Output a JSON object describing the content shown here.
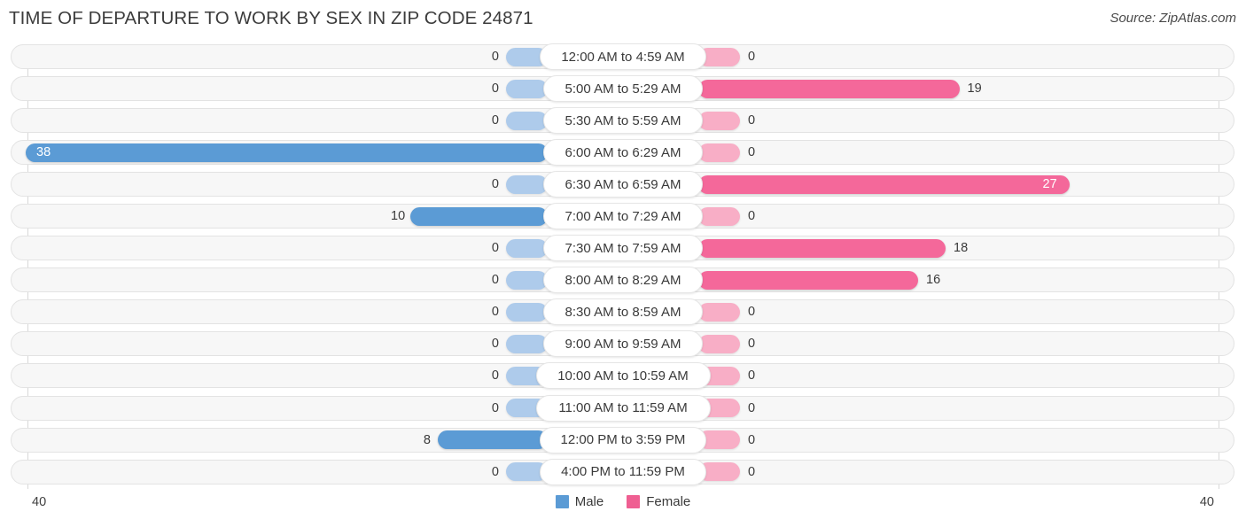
{
  "header": {
    "title": "TIME OF DEPARTURE TO WORK BY SEX IN ZIP CODE 24871",
    "source": "Source: ZipAtlas.com"
  },
  "legend": {
    "male_label": "Male",
    "female_label": "Female",
    "male_color": "#5b9bd5",
    "female_color": "#ef5f92"
  },
  "axis": {
    "left_max": "40",
    "right_max": "40"
  },
  "chart_data": {
    "type": "bar",
    "orientation": "horizontal-diverging",
    "title": "TIME OF DEPARTURE TO WORK BY SEX IN ZIP CODE 24871",
    "xlabel": "",
    "ylabel": "",
    "xlim": [
      40,
      40
    ],
    "grid": true,
    "legend_position": "bottom-center",
    "categories": [
      "12:00 AM to 4:59 AM",
      "5:00 AM to 5:29 AM",
      "5:30 AM to 5:59 AM",
      "6:00 AM to 6:29 AM",
      "6:30 AM to 6:59 AM",
      "7:00 AM to 7:29 AM",
      "7:30 AM to 7:59 AM",
      "8:00 AM to 8:29 AM",
      "8:30 AM to 8:59 AM",
      "9:00 AM to 9:59 AM",
      "10:00 AM to 10:59 AM",
      "11:00 AM to 11:59 AM",
      "12:00 PM to 3:59 PM",
      "4:00 PM to 11:59 PM"
    ],
    "series": [
      {
        "name": "Male",
        "values": [
          0,
          0,
          0,
          38,
          0,
          10,
          0,
          0,
          0,
          0,
          0,
          0,
          8,
          0
        ]
      },
      {
        "name": "Female",
        "values": [
          0,
          19,
          0,
          0,
          27,
          0,
          18,
          16,
          0,
          0,
          0,
          0,
          0,
          0
        ]
      }
    ]
  },
  "rows": [
    {
      "label": "12:00 AM to 4:59 AM",
      "male": "0",
      "female": "0"
    },
    {
      "label": "5:00 AM to 5:29 AM",
      "male": "0",
      "female": "19"
    },
    {
      "label": "5:30 AM to 5:59 AM",
      "male": "0",
      "female": "0"
    },
    {
      "label": "6:00 AM to 6:29 AM",
      "male": "38",
      "female": "0"
    },
    {
      "label": "6:30 AM to 6:59 AM",
      "male": "0",
      "female": "27"
    },
    {
      "label": "7:00 AM to 7:29 AM",
      "male": "10",
      "female": "0"
    },
    {
      "label": "7:30 AM to 7:59 AM",
      "male": "0",
      "female": "18"
    },
    {
      "label": "8:00 AM to 8:29 AM",
      "male": "0",
      "female": "16"
    },
    {
      "label": "8:30 AM to 8:59 AM",
      "male": "0",
      "female": "0"
    },
    {
      "label": "9:00 AM to 9:59 AM",
      "male": "0",
      "female": "0"
    },
    {
      "label": "10:00 AM to 10:59 AM",
      "male": "0",
      "female": "0"
    },
    {
      "label": "11:00 AM to 11:59 AM",
      "male": "0",
      "female": "0"
    },
    {
      "label": "12:00 PM to 3:59 PM",
      "male": "8",
      "female": "0"
    },
    {
      "label": "4:00 PM to 11:59 PM",
      "male": "0",
      "female": "0"
    }
  ]
}
